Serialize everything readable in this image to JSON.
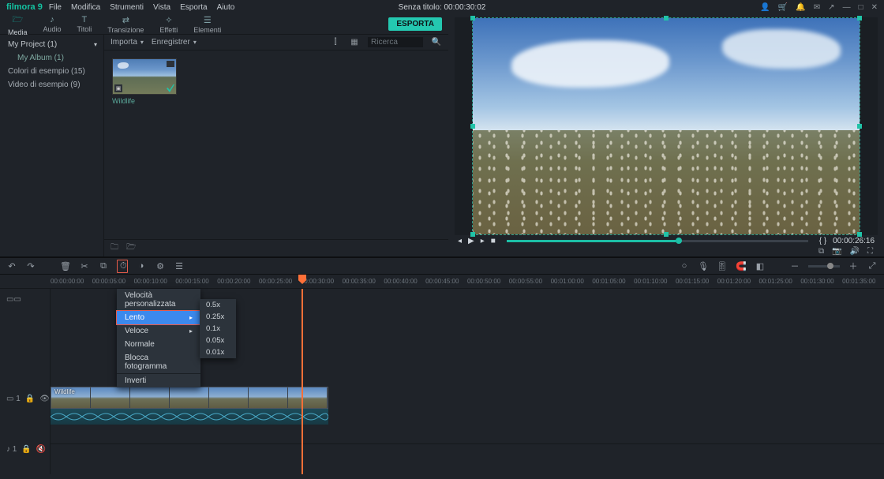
{
  "title": {
    "app": "filmora 9",
    "project": "Senza titolo:",
    "time": "00:00:30:02"
  },
  "menu": [
    "File",
    "Modifica",
    "Strumenti",
    "Vista",
    "Esporta",
    "Aiuto"
  ],
  "topIcons": [
    "👤",
    "🛒",
    "🔔",
    "✉",
    "↗",
    "—",
    "□",
    "✕"
  ],
  "tabs": [
    {
      "icon": "🗁",
      "label": "Media",
      "active": true
    },
    {
      "icon": "♪",
      "label": "Audio"
    },
    {
      "icon": "T",
      "label": "Titoli"
    },
    {
      "icon": "⇄",
      "label": "Transizione"
    },
    {
      "icon": "✧",
      "label": "Effetti"
    },
    {
      "icon": "☰",
      "label": "Elementi"
    }
  ],
  "exportLabel": "ESPORTA",
  "sidebar": {
    "tree": [
      {
        "label": "My Project (1)",
        "type": "head"
      },
      {
        "label": "My Album (1)",
        "type": "child"
      },
      {
        "label": "Colori di esempio (15)",
        "type": "item"
      },
      {
        "label": "Video di esempio (9)",
        "type": "item"
      }
    ]
  },
  "libbar": {
    "import": "Importa",
    "save": "Enregistrer",
    "searchPlaceholder": "Ricerca"
  },
  "clip": {
    "name": "Wildlife"
  },
  "preview": {
    "timecode": "00:00:26:16"
  },
  "tlIcons": {
    "undo": "↶",
    "redo": "↷",
    "del": "🗑",
    "cut": "✂",
    "crop": "⧉",
    "speed": "⏱",
    "color": "◑",
    "stab": "⚙",
    "green": "☰",
    "rec": "○",
    "mic": "🎙",
    "mix": "🎚",
    "snap": "🧲",
    "marker": "◧",
    "plus": "＋",
    "fit": "⤢",
    "minus": "－"
  },
  "ruler": [
    "00:00:00:00",
    "00:00:05:00",
    "00:00:10:00",
    "00:00:15:00",
    "00:00:20:00",
    "00:00:25:00",
    "00:00:30:00",
    "00:00:35:00",
    "00:00:40:00",
    "00:00:45:00",
    "00:00:50:00",
    "00:00:55:00",
    "00:01:00:00",
    "00:01:05:00",
    "00:01:10:00",
    "00:01:15:00",
    "00:01:20:00",
    "00:01:25:00",
    "00:01:30:00",
    "00:01:35:00"
  ],
  "speedMenu": {
    "items": [
      "Velocità personalizzata",
      "Lento",
      "Veloce",
      "Normale",
      "Blocca fotogramma",
      "Inverti"
    ],
    "highlight": 1,
    "sub": [
      "0.5x",
      "0.25x",
      "0.1x",
      "0.05x",
      "0.01x"
    ]
  },
  "trackLabels": {
    "video": "▭ 1",
    "music": "♪ 1",
    "lock": "🔒",
    "eye": "👁",
    "mute": "🔇"
  },
  "clipTitle": "Wildlife"
}
